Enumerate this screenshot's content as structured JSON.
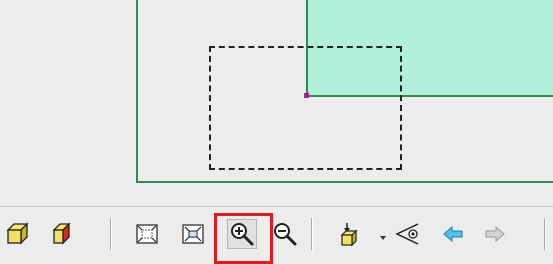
{
  "toolbar": {
    "buttons": [
      {
        "name": "shaded-cube-icon"
      },
      {
        "name": "red-face-cube-icon"
      },
      {
        "name": "zoom-extents-icon"
      },
      {
        "name": "zoom-selection-icon"
      },
      {
        "name": "zoom-in-icon",
        "selected": true
      },
      {
        "name": "zoom-out-icon"
      },
      {
        "name": "view-direction-icon"
      },
      {
        "name": "eye-view-icon"
      },
      {
        "name": "arrow-left-icon"
      },
      {
        "name": "arrow-right-icon"
      }
    ]
  },
  "colors": {
    "region_fill": "#b3f0d9",
    "region_border": "#2e8b57",
    "highlight_border": "#e0191e",
    "anchor_point": "#b0179e"
  }
}
